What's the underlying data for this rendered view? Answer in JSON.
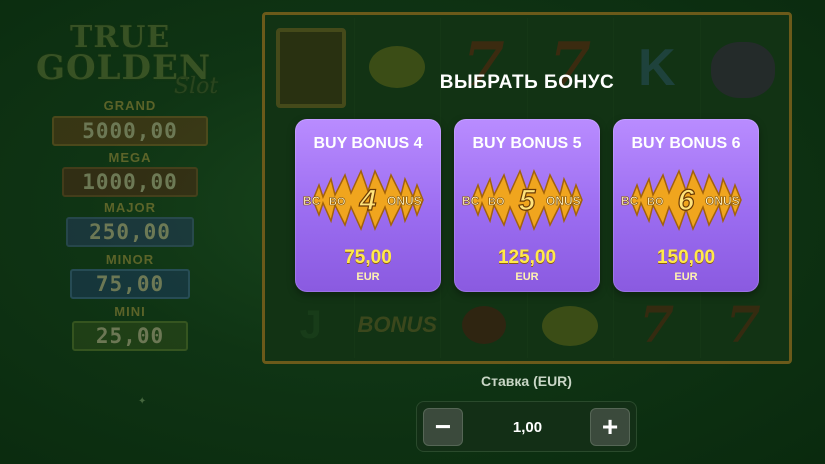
{
  "logo": {
    "line1": "TRUE",
    "line2": "GOLDEN",
    "line3": "Slot"
  },
  "jackpots": [
    {
      "label": "GRAND",
      "value": "5000,00"
    },
    {
      "label": "MEGA",
      "value": "1000,00"
    },
    {
      "label": "MAJOR",
      "value": "250,00"
    },
    {
      "label": "MINOR",
      "value": "75,00"
    },
    {
      "label": "MINI",
      "value": "25,00"
    }
  ],
  "reels": {
    "symbols_top": [
      "book-icon",
      "lemon-icon",
      "seven-icon",
      "seven-icon",
      "k-letter-icon",
      "grape-icon"
    ],
    "symbols_bottom": [
      "j-letter-icon",
      "bonus-icon",
      "cherry-icon",
      "lemon-icon",
      "seven-icon",
      "seven-icon"
    ],
    "k_text": "K",
    "seven_text": "7",
    "bonus_text": "BONUS",
    "j_text": "J"
  },
  "bonus_select": {
    "title": "ВЫБРАТЬ БОНУС",
    "cards": [
      {
        "title": "BUY BONUS 4",
        "number": "4",
        "price": "75,00",
        "currency": "EUR"
      },
      {
        "title": "BUY BONUS 5",
        "number": "5",
        "price": "125,00",
        "currency": "EUR"
      },
      {
        "title": "BUY BONUS 6",
        "number": "6",
        "price": "150,00",
        "currency": "EUR"
      }
    ],
    "badge_text": "BONUS"
  },
  "bet": {
    "label": "Ставка (EUR)",
    "value": "1,00",
    "minus": "−",
    "plus": "+"
  },
  "colors": {
    "card": "#9b6cf0",
    "price": "#ffe94a",
    "badge_star": "#f0a51e",
    "background": "#0f3414"
  }
}
